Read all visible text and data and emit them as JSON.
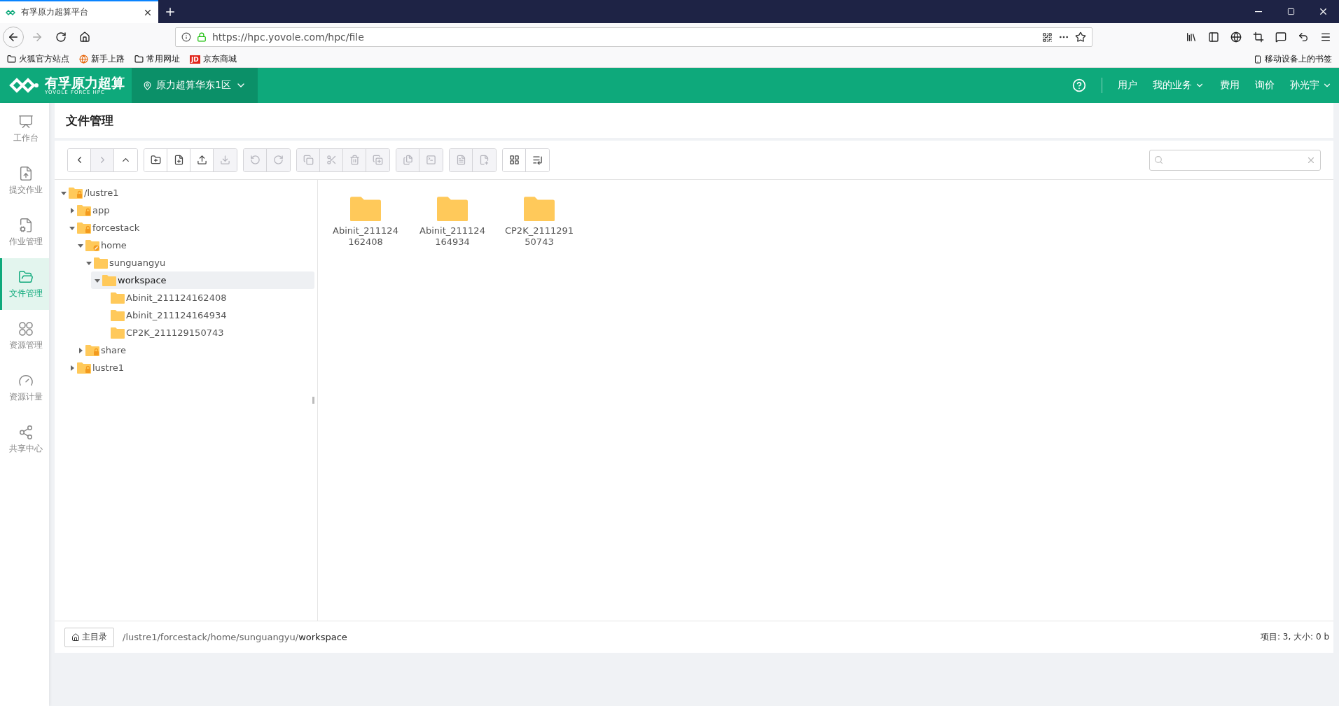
{
  "browser": {
    "tab_title": "有孚原力超算平台",
    "url": "https://hpc.yovole.com/hpc/file",
    "bookmarks": [
      {
        "kind": "folder",
        "label": "火狐官方站点"
      },
      {
        "kind": "globe",
        "label": "新手上路"
      },
      {
        "kind": "folder",
        "label": "常用网址"
      },
      {
        "kind": "jd",
        "label": "京东商城",
        "logo": "JD"
      }
    ],
    "mobile_bookmarks": "移动设备上的书签"
  },
  "header": {
    "logo_text": "有孚原力超算",
    "logo_sub": "YOVOLE FORCE HPC",
    "region": "原力超算华东1区",
    "nav": [
      {
        "label": "用户",
        "dropdown": false
      },
      {
        "label": "我的业务",
        "dropdown": true
      },
      {
        "label": "费用",
        "dropdown": false
      },
      {
        "label": "询价",
        "dropdown": false
      },
      {
        "label": "孙光宇",
        "dropdown": true
      }
    ]
  },
  "sidebar": {
    "items": [
      {
        "label": "工作台",
        "selected": false
      },
      {
        "label": "提交作业",
        "selected": false
      },
      {
        "label": "作业管理",
        "selected": false
      },
      {
        "label": "文件管理",
        "selected": true
      },
      {
        "label": "资源管理",
        "selected": false
      },
      {
        "label": "资源计量",
        "selected": false
      },
      {
        "label": "共享中心",
        "selected": false
      }
    ]
  },
  "page_title": "文件管理",
  "toolbar": {
    "groups": [
      [
        {
          "disabled": false
        },
        {
          "disabled": true
        },
        {
          "disabled": false
        }
      ],
      [
        {
          "disabled": false
        },
        {
          "disabled": false
        },
        {
          "disabled": false
        },
        {
          "disabled": true
        }
      ],
      [
        {
          "disabled": true
        },
        {
          "disabled": true
        }
      ],
      [
        {
          "disabled": true
        },
        {
          "disabled": true
        },
        {
          "disabled": true
        },
        {
          "disabled": true
        }
      ],
      [
        {
          "disabled": true
        },
        {
          "disabled": true
        }
      ],
      [
        {
          "disabled": true
        },
        {
          "disabled": true
        }
      ],
      [
        {
          "disabled": false
        },
        {
          "disabled": false
        }
      ]
    ]
  },
  "tree": [
    {
      "label": "/lustre1",
      "kind": "locked",
      "expanded": true,
      "selected": false,
      "children": [
        {
          "label": "app",
          "kind": "locked",
          "expanded": false,
          "selected": false
        },
        {
          "label": "forcestack",
          "kind": "locked",
          "expanded": true,
          "selected": false,
          "children": [
            {
              "label": "home",
              "kind": "shared",
              "expanded": true,
              "selected": false,
              "children": [
                {
                  "label": "sunguangyu",
                  "expanded": true,
                  "selected": false,
                  "children": [
                    {
                      "label": "workspace",
                      "expanded": true,
                      "selected": true,
                      "children": [
                        {
                          "label": "Abinit_211124162408",
                          "selected": false
                        },
                        {
                          "label": "Abinit_211124164934",
                          "selected": false
                        },
                        {
                          "label": "CP2K_211129150743",
                          "selected": false
                        }
                      ]
                    }
                  ]
                }
              ]
            },
            {
              "label": "share",
              "kind": "locked",
              "expanded": false,
              "selected": false
            }
          ]
        },
        {
          "label": "lustre1",
          "kind": "locked",
          "expanded": false,
          "selected": false
        }
      ]
    }
  ],
  "files": [
    {
      "name": "Abinit_211124162408"
    },
    {
      "name": "Abinit_211124164934"
    },
    {
      "name": "CP2K_211129150743"
    }
  ],
  "status_bar": {
    "home_button": "主目录",
    "path": "/lustre1/forcestack/home/sunguangyu/",
    "current": "workspace",
    "summary": "项目: 3, 大小: 0 b"
  }
}
